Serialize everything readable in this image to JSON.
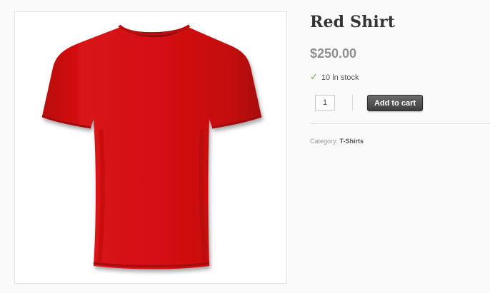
{
  "product": {
    "title": "Red Shirt",
    "price": "$250.00",
    "stock_text": "10 in stock",
    "quantity": "1",
    "add_to_cart_label": "Add to cart",
    "category_label": "Category:",
    "category_link": "T-Shirts",
    "image": {
      "subject": "red t-shirt",
      "color": "#d10f10"
    }
  },
  "colors": {
    "stock_check": "#6ea84a",
    "price": "#8f8f8f",
    "button": "#4a4a4a"
  },
  "icons": {
    "stock": "check-icon"
  }
}
